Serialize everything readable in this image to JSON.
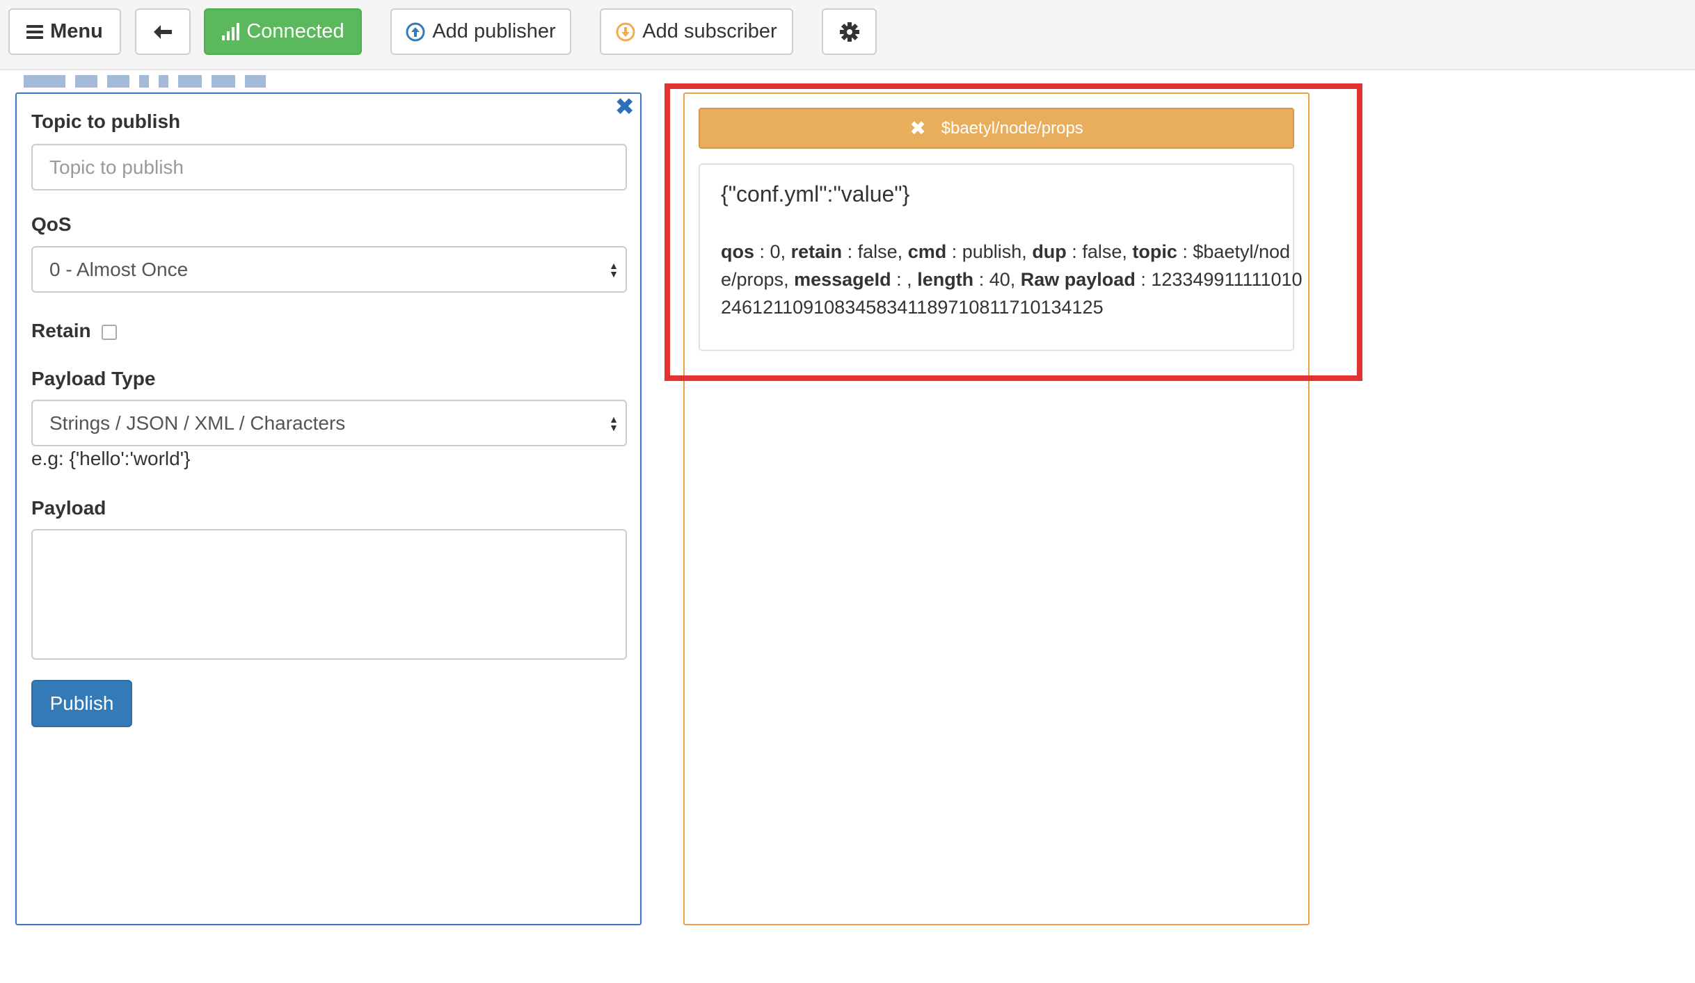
{
  "toolbar": {
    "menu_label": "Menu",
    "connected_label": "Connected",
    "add_publisher_label": "Add publisher",
    "add_subscriber_label": "Add subscriber",
    "icons": {
      "back": "arrow-left-icon",
      "signal": "signal-bars-icon",
      "add_publisher": "arrow-up-circle-icon",
      "add_subscriber": "arrow-down-circle-icon",
      "settings": "gear-icon"
    },
    "colors": {
      "connected": "#5cb85c",
      "publisher_icon": "#337ab7",
      "subscriber_icon": "#f0ad4e"
    }
  },
  "publisher": {
    "topic_label": "Topic to publish",
    "topic_placeholder": "Topic to publish",
    "qos_label": "QoS",
    "qos_selected": "0 - Almost Once",
    "retain_label": "Retain",
    "retain_checked": false,
    "payload_type_label": "Payload Type",
    "payload_type_selected": "Strings / JSON / XML / Characters",
    "payload_hint": "e.g: {'hello':'world'}",
    "payload_label": "Payload",
    "payload_value": "",
    "publish_label": "Publish",
    "colors": {
      "border": "#3c78c8",
      "publish_button": "#337ab7"
    }
  },
  "subscriber": {
    "topic": "$baetyl/node/props",
    "colors": {
      "header": "#e9ae5c",
      "border": "#f0a04b",
      "highlight": "#e23333"
    },
    "message": {
      "payload": "{\"conf.yml\":\"value\"}",
      "qos_key": "qos",
      "qos_value": "0",
      "retain_key": "retain",
      "retain_value": "false",
      "cmd_key": "cmd",
      "cmd_value": "publish",
      "dup_key": "dup",
      "dup_value": "false",
      "topic_key": "topic",
      "topic_value": "$baetyl/node/props",
      "messageid_key": "messageId",
      "messageid_value": "",
      "length_key": "length",
      "length_value": "40",
      "raw_payload_key": "Raw payload",
      "raw_payload_value": "1233499111110102461211091083458341189710811710134125"
    }
  }
}
